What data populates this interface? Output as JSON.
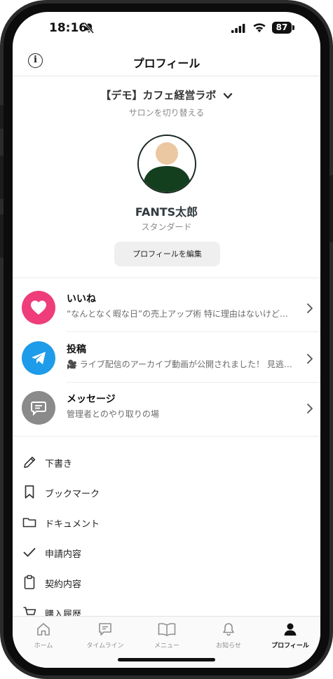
{
  "status_bar": {
    "time": "18:16",
    "battery": "87"
  },
  "header": {
    "title": "プロフィール"
  },
  "profile": {
    "salon_name": "【デモ】カフェ経営ラボ",
    "switch_label": "サロンを切り替える",
    "user_name": "FANTS太郎",
    "plan": "スタンダード",
    "edit_button": "プロフィールを編集"
  },
  "activity": [
    {
      "title": "いいね",
      "subtitle": "“なんとなく暇な日”の売上アップ術 特に理由はないけど…",
      "icon": "heart-icon",
      "color": "#ee3d7a"
    },
    {
      "title": "投稿",
      "subtitle": "🎥 ライブ配信のアーカイブ動画が公開されました！ 見逃した方…",
      "icon": "send-icon",
      "color": "#1e9be9"
    },
    {
      "title": "メッセージ",
      "subtitle": "管理者とのやり取りの場",
      "icon": "message-icon",
      "color": "#8a8a8a"
    }
  ],
  "menu": [
    {
      "label": "下書き",
      "icon": "pencil-icon"
    },
    {
      "label": "ブックマーク",
      "icon": "bookmark-icon"
    },
    {
      "label": "ドキュメント",
      "icon": "folder-icon"
    },
    {
      "label": "申請内容",
      "icon": "check-icon"
    },
    {
      "label": "契約内容",
      "icon": "clipboard-icon"
    },
    {
      "label": "購入履歴",
      "icon": "cart-icon"
    }
  ],
  "tabs": [
    {
      "label": "ホーム",
      "icon": "home-icon",
      "active": false
    },
    {
      "label": "タイムライン",
      "icon": "timeline-icon",
      "active": false
    },
    {
      "label": "メニュー",
      "icon": "book-icon",
      "active": false
    },
    {
      "label": "お知らせ",
      "icon": "bell-icon",
      "active": false
    },
    {
      "label": "プロフィール",
      "icon": "person-icon",
      "active": true
    }
  ]
}
